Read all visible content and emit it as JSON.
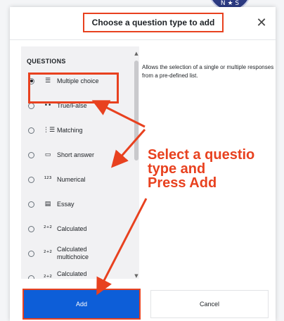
{
  "dialog": {
    "title": "Choose a question type to add",
    "close_icon": "close-icon",
    "close_glyph": "✕"
  },
  "questions": {
    "section_label": "QUESTIONS",
    "options": [
      {
        "label": "Multiple choice",
        "icon": "list-icon",
        "glyph": "☰",
        "selected": true
      },
      {
        "label": "True/False",
        "icon": "dots-icon",
        "glyph": "••",
        "selected": false
      },
      {
        "label": "Matching",
        "icon": "matching-grid-icon",
        "glyph": "⋮☰",
        "selected": false
      },
      {
        "label": "Short answer",
        "icon": "textbox-icon",
        "glyph": "▭",
        "selected": false
      },
      {
        "label": "Numerical",
        "icon": "numbers-icon",
        "glyph": "¹²³",
        "selected": false
      },
      {
        "label": "Essay",
        "icon": "document-icon",
        "glyph": "▤",
        "selected": false
      },
      {
        "label": "Calculated",
        "icon": "calculated-icon",
        "glyph": "²⁺²",
        "selected": false
      },
      {
        "label": "Calculated multichoice",
        "icon": "calculated-multichoice-icon",
        "glyph": "²⁺²",
        "selected": false
      },
      {
        "label": "Calculated simple",
        "icon": "calculated-simple-icon",
        "glyph": "²⁺²",
        "selected": false
      }
    ]
  },
  "description": "Allows the selection of a single or multiple responses from a pre-defined list.",
  "footer": {
    "add_label": "Add",
    "cancel_label": "Cancel"
  },
  "annotation": {
    "line1": "Select a questio",
    "line2": "type and",
    "line3": "Press Add"
  },
  "colors": {
    "accent_red": "#e8411f",
    "primary_blue": "#0d5ed8"
  }
}
